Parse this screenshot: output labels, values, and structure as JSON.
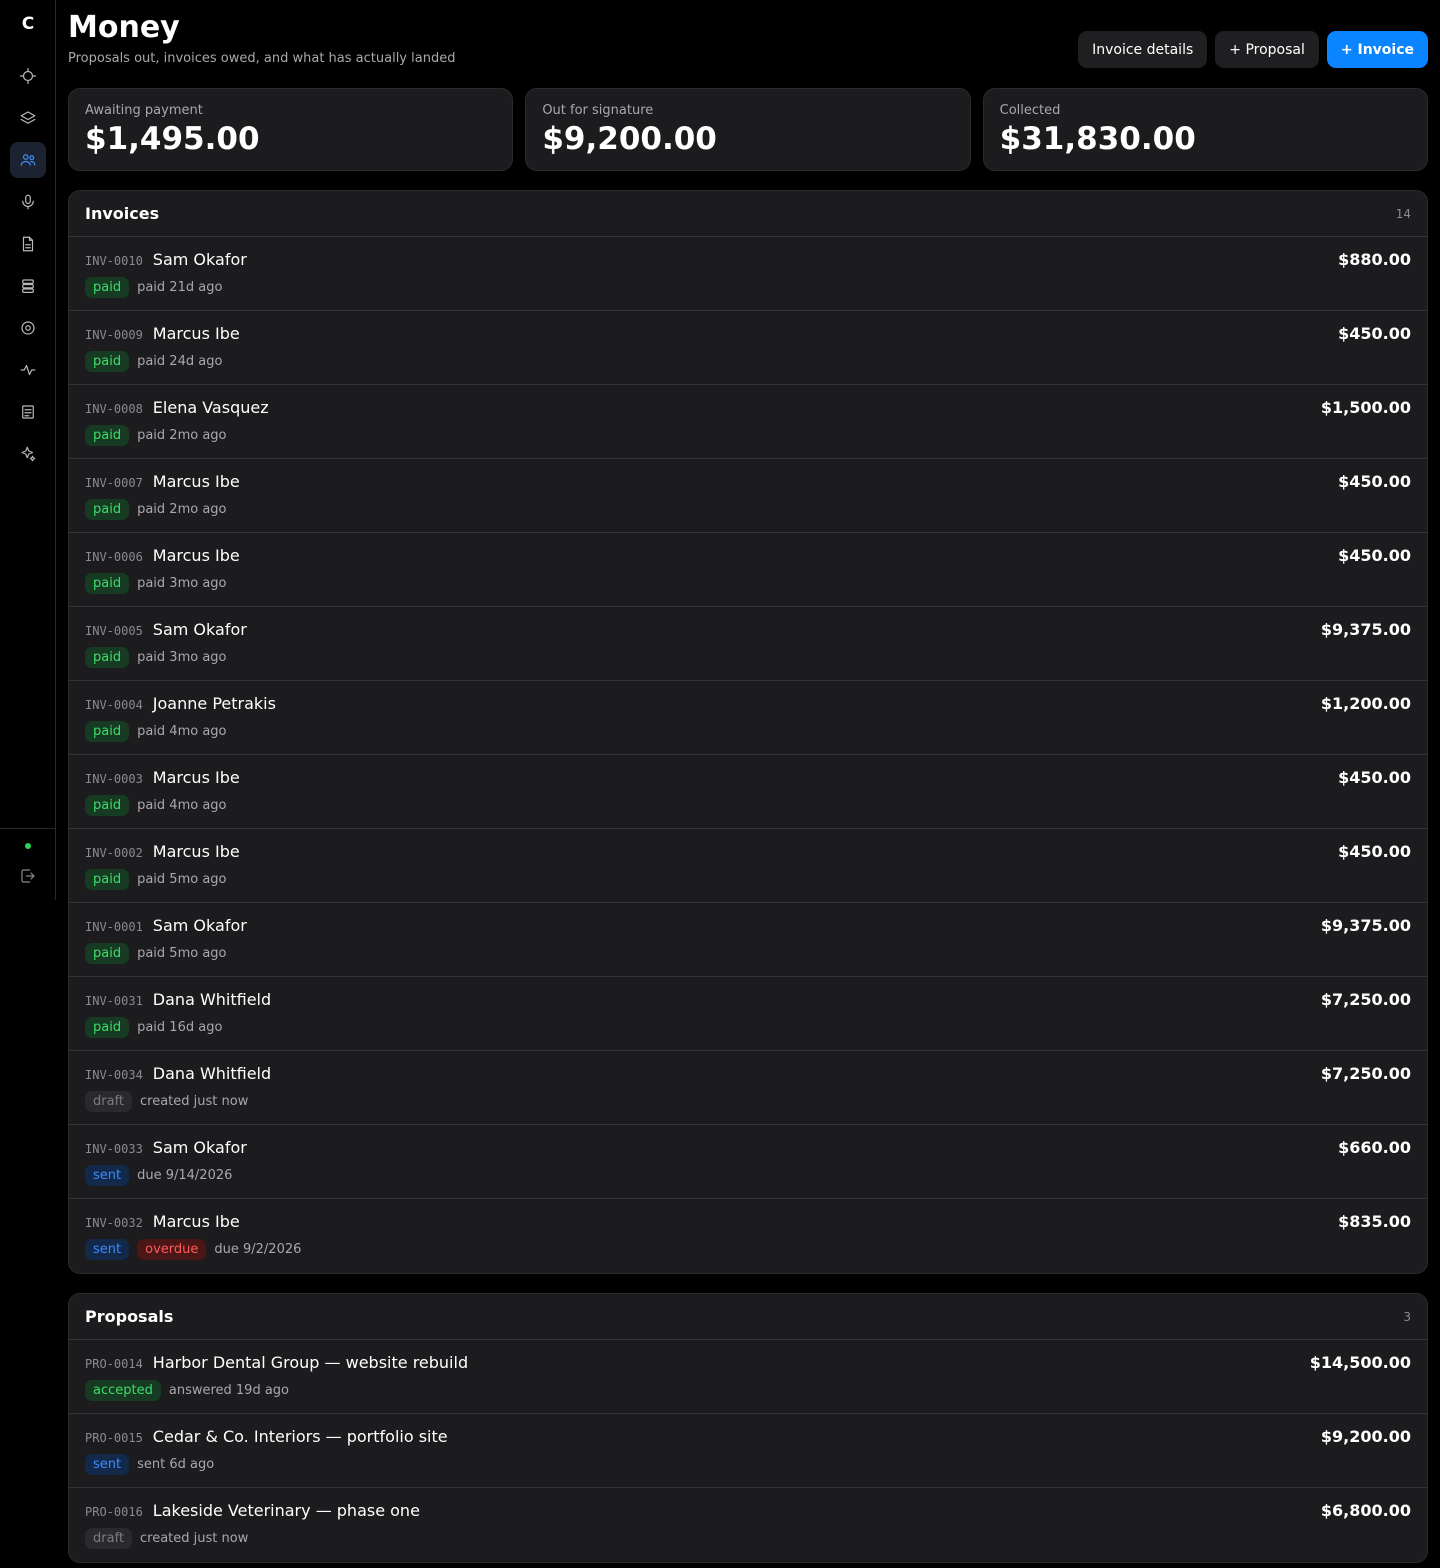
{
  "sidebar": {
    "logo": "C",
    "items": [
      {
        "icon": "crosshair-icon",
        "name": "nav-crosshair"
      },
      {
        "icon": "layers-icon",
        "name": "nav-layers"
      },
      {
        "icon": "users-icon",
        "name": "nav-users",
        "active": true
      },
      {
        "icon": "microphone-icon",
        "name": "nav-microphone"
      },
      {
        "icon": "document-icon",
        "name": "nav-document"
      },
      {
        "icon": "database-icon",
        "name": "nav-database"
      },
      {
        "icon": "target-icon",
        "name": "nav-target"
      },
      {
        "icon": "activity-icon",
        "name": "nav-activity"
      },
      {
        "icon": "notes-icon",
        "name": "nav-notes"
      },
      {
        "icon": "sparkle-icon",
        "name": "nav-sparkle"
      }
    ],
    "status_color": "#30d158",
    "logout_icon": "logout-icon"
  },
  "header": {
    "title": "Money",
    "subtitle": "Proposals out, invoices owed, and what has actually landed",
    "buttons": {
      "invoice_details": "Invoice details",
      "proposal": "+ Proposal",
      "invoice": "+ Invoice"
    }
  },
  "stats": [
    {
      "label": "Awaiting payment",
      "value": "$1,495.00"
    },
    {
      "label": "Out for signature",
      "value": "$9,200.00"
    },
    {
      "label": "Collected",
      "value": "$31,830.00"
    }
  ],
  "invoices": {
    "title": "Invoices",
    "count": "14",
    "rows": [
      {
        "id": "INV-0010",
        "name": "Sam Okafor",
        "amount": "$880.00",
        "badges": [
          "paid"
        ],
        "meta": "paid 21d ago"
      },
      {
        "id": "INV-0009",
        "name": "Marcus Ibe",
        "amount": "$450.00",
        "badges": [
          "paid"
        ],
        "meta": "paid 24d ago"
      },
      {
        "id": "INV-0008",
        "name": "Elena Vasquez",
        "amount": "$1,500.00",
        "badges": [
          "paid"
        ],
        "meta": "paid 2mo ago"
      },
      {
        "id": "INV-0007",
        "name": "Marcus Ibe",
        "amount": "$450.00",
        "badges": [
          "paid"
        ],
        "meta": "paid 2mo ago"
      },
      {
        "id": "INV-0006",
        "name": "Marcus Ibe",
        "amount": "$450.00",
        "badges": [
          "paid"
        ],
        "meta": "paid 3mo ago"
      },
      {
        "id": "INV-0005",
        "name": "Sam Okafor",
        "amount": "$9,375.00",
        "badges": [
          "paid"
        ],
        "meta": "paid 3mo ago"
      },
      {
        "id": "INV-0004",
        "name": "Joanne Petrakis",
        "amount": "$1,200.00",
        "badges": [
          "paid"
        ],
        "meta": "paid 4mo ago"
      },
      {
        "id": "INV-0003",
        "name": "Marcus Ibe",
        "amount": "$450.00",
        "badges": [
          "paid"
        ],
        "meta": "paid 4mo ago"
      },
      {
        "id": "INV-0002",
        "name": "Marcus Ibe",
        "amount": "$450.00",
        "badges": [
          "paid"
        ],
        "meta": "paid 5mo ago"
      },
      {
        "id": "INV-0001",
        "name": "Sam Okafor",
        "amount": "$9,375.00",
        "badges": [
          "paid"
        ],
        "meta": "paid 5mo ago"
      },
      {
        "id": "INV-0031",
        "name": "Dana Whitfield",
        "amount": "$7,250.00",
        "badges": [
          "paid"
        ],
        "meta": "paid 16d ago"
      },
      {
        "id": "INV-0034",
        "name": "Dana Whitfield",
        "amount": "$7,250.00",
        "badges": [
          "draft"
        ],
        "meta": "created just now"
      },
      {
        "id": "INV-0033",
        "name": "Sam Okafor",
        "amount": "$660.00",
        "badges": [
          "sent"
        ],
        "meta": "due 9/14/2026"
      },
      {
        "id": "INV-0032",
        "name": "Marcus Ibe",
        "amount": "$835.00",
        "badges": [
          "sent",
          "overdue"
        ],
        "meta": "due 9/2/2026"
      }
    ]
  },
  "proposals": {
    "title": "Proposals",
    "count": "3",
    "rows": [
      {
        "id": "PRO-0014",
        "name": "Harbor Dental Group — website rebuild",
        "amount": "$14,500.00",
        "badges": [
          "accepted"
        ],
        "meta": "answered 19d ago"
      },
      {
        "id": "PRO-0015",
        "name": "Cedar & Co. Interiors — portfolio site",
        "amount": "$9,200.00",
        "badges": [
          "sent"
        ],
        "meta": "sent 6d ago"
      },
      {
        "id": "PRO-0016",
        "name": "Lakeside Veterinary — phase one",
        "amount": "$6,800.00",
        "badges": [
          "draft"
        ],
        "meta": "created just now"
      }
    ]
  },
  "colors": {
    "accent": "#0a84ff",
    "paid": "#3ddc6a",
    "sent": "#3d8bff",
    "overdue": "#ff5c5c",
    "draft": "#7c7c80"
  }
}
